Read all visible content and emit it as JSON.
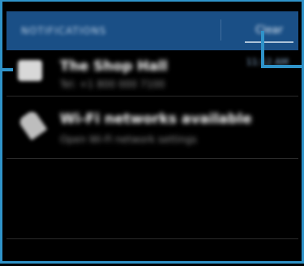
{
  "header": {
    "title": "NOTIFICATIONS",
    "clear_label": "Clear"
  },
  "notifications": [
    {
      "title": "The Shop Hall",
      "subtitle": "Tel: +1 800 000 7100",
      "time": "11:12 AM",
      "icon": "message-icon"
    },
    {
      "title": "Wi-Fi networks available",
      "subtitle": "Open Wi-Fi network settings",
      "time": "",
      "icon": "wifi-icon"
    }
  ],
  "colors": {
    "header_bg": "#1a4f86",
    "callout": "#2f93c9",
    "background": "#000000"
  }
}
